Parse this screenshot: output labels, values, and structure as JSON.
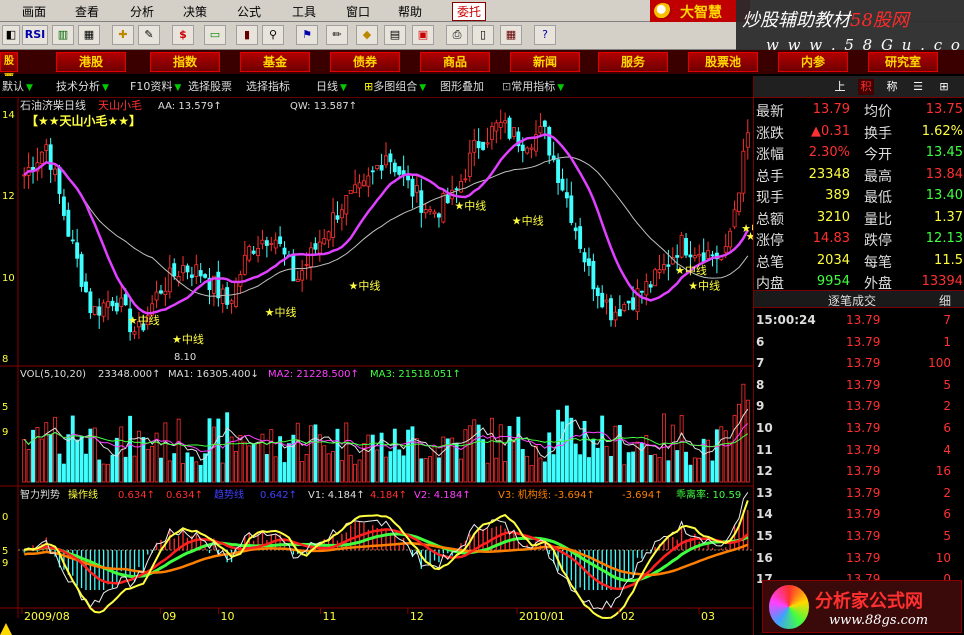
{
  "menu": [
    "画面",
    "查看",
    "分析",
    "决策",
    "公式",
    "工具",
    "窗口",
    "帮助"
  ],
  "menu_active": "委托",
  "brand": "大智慧",
  "watermark": {
    "line1_a": "炒股辅助教材",
    "line1_b": "58股网",
    "line2": "w w w . 5 8 G u . c o m"
  },
  "toolbar": {
    "rsi": "RSI",
    "dollar": "$"
  },
  "categories": [
    "股票",
    "港股",
    "指数",
    "基金",
    "债券",
    "商品",
    "新闻",
    "服务",
    "股票池",
    "内参",
    "研究室"
  ],
  "subbar": {
    "default": "默认",
    "tech": "技术分析",
    "f10": "F10资料",
    "select": "选择股票",
    "indicator": "选择指标",
    "period": "日线",
    "multi": "多图组合",
    "overlay": "图形叠加",
    "common": "常用指标"
  },
  "right_tabs": [
    "上",
    "积",
    "称",
    "☰",
    "⊞"
  ],
  "quote": [
    {
      "l": "最新",
      "v": "13.79",
      "c": "#ff3030",
      "l2": "均价",
      "v2": "13.75",
      "c2": "#ff3030"
    },
    {
      "l": "涨跌",
      "v": "▲0.31",
      "c": "#ff3030",
      "l2": "换手",
      "v2": "1.62%",
      "c2": "#ffff40"
    },
    {
      "l": "涨幅",
      "v": "2.30%",
      "c": "#ff3030",
      "l2": "今开",
      "v2": "13.45",
      "c2": "#40ff40"
    },
    {
      "l": "总手",
      "v": "23348",
      "c": "#ffff40",
      "l2": "最高",
      "v2": "13.84",
      "c2": "#ff3030"
    },
    {
      "l": "现手",
      "v": "389",
      "c": "#ffff40",
      "l2": "最低",
      "v2": "13.40",
      "c2": "#40ff40"
    },
    {
      "l": "总额",
      "v": "3210",
      "c": "#ffff40",
      "l2": "量比",
      "v2": "1.37",
      "c2": "#ffff40"
    },
    {
      "l": "涨停",
      "v": "14.83",
      "c": "#ff3030",
      "l2": "跌停",
      "v2": "12.13",
      "c2": "#40ff40"
    },
    {
      "l": "总笔",
      "v": "2034",
      "c": "#ffff40",
      "l2": "每笔",
      "v2": "11.5",
      "c2": "#ffff40"
    },
    {
      "l": "内盘",
      "v": "9954",
      "c": "#40ff40",
      "l2": "外盘",
      "v2": "13394",
      "c2": "#ff3030"
    }
  ],
  "trades_header": {
    "title": "逐笔成交",
    "detail": "细"
  },
  "trades": [
    {
      "t": "15:00:24",
      "p": "13.79",
      "v": "7"
    },
    {
      "t": "6",
      "p": "13.79",
      "v": "1"
    },
    {
      "t": "7",
      "p": "13.79",
      "v": "100"
    },
    {
      "t": "8",
      "p": "13.79",
      "v": "5"
    },
    {
      "t": "9",
      "p": "13.79",
      "v": "2"
    },
    {
      "t": "10",
      "p": "13.79",
      "v": "6"
    },
    {
      "t": "11",
      "p": "13.79",
      "v": "4"
    },
    {
      "t": "12",
      "p": "13.79",
      "v": "16"
    },
    {
      "t": "13",
      "p": "13.79",
      "v": "2"
    },
    {
      "t": "14",
      "p": "13.79",
      "v": "6"
    },
    {
      "t": "15",
      "p": "13.79",
      "v": "5"
    },
    {
      "t": "16",
      "p": "13.79",
      "v": "10"
    },
    {
      "t": "17",
      "p": "13.79",
      "v": "0"
    }
  ],
  "price_panel": {
    "name": "石油济柴日线",
    "indicator": "天山小毛",
    "aa": "AA: 13.579↑",
    "qw": "QW: 13.587↑",
    "title_label": "【★★天山小毛★★】",
    "mid_label": "★中线",
    "low_mark": "8.10",
    "y_labels": [
      "14",
      "12",
      "10",
      "8"
    ]
  },
  "vol_panel": {
    "title": "VOL(5,10,20)",
    "vol": "23348.000↑",
    "ma1": "MA1: 16305.400↓",
    "ma2": "MA2: 21228.500↑",
    "ma3": "MA3: 21518.051↑",
    "y_labels": [
      "5",
      "9"
    ]
  },
  "ind_panel": {
    "title": "智力判势",
    "op": "操作线",
    "v0": "0.634↑",
    "v1": "0.634↑",
    "hidden_label": "趋势线",
    "v2hidden": "0.642↑",
    "vline1": "V1: 4.184↑",
    "vline1b": "4.184↑",
    "vline2": "V2: 4.184↑",
    "vline3": "V3: 机构线: -3.694↑",
    "vline3b": "-3.694↑",
    "dev": "乖离率: 10.59",
    "y_labels": [
      "0",
      "5",
      "9"
    ]
  },
  "x_axis": [
    "2009/08",
    "09",
    "10",
    "11",
    "12",
    "2010/01",
    "02",
    "03"
  ],
  "ad": {
    "text": "分析家公式网",
    "url": "www.88gs.com"
  },
  "colors": {
    "up": "#ff3030",
    "down": "#40ffff",
    "ma_purple": "#e040ff",
    "ma_gray": "#c0c0c0",
    "yellow": "#ffff40",
    "green": "#40ff40",
    "orange": "#ff8000"
  },
  "chart_data": {
    "type": "line",
    "title": "石油济柴日线",
    "series_names": [
      "AA",
      "QW"
    ],
    "ylim": [
      8,
      14.6
    ],
    "ticks_y": [
      8,
      10,
      12,
      14
    ],
    "x": [
      "2009/08",
      "09",
      "10",
      "11",
      "12",
      "2010/01",
      "02",
      "03"
    ],
    "close_approx": [
      12.8,
      13.6,
      11.2,
      9.2,
      9.6,
      8.6,
      9.8,
      10.4,
      10.2,
      9.4,
      10.9,
      11.3,
      10.0,
      11.0,
      12.0,
      12.4,
      13.4,
      12.5,
      11.8,
      12.2,
      13.6,
      14.1,
      13.7,
      13.9,
      12.2,
      10.2,
      9.2,
      9.6,
      10.1,
      11.0,
      10.8,
      10.6,
      13.8
    ]
  }
}
